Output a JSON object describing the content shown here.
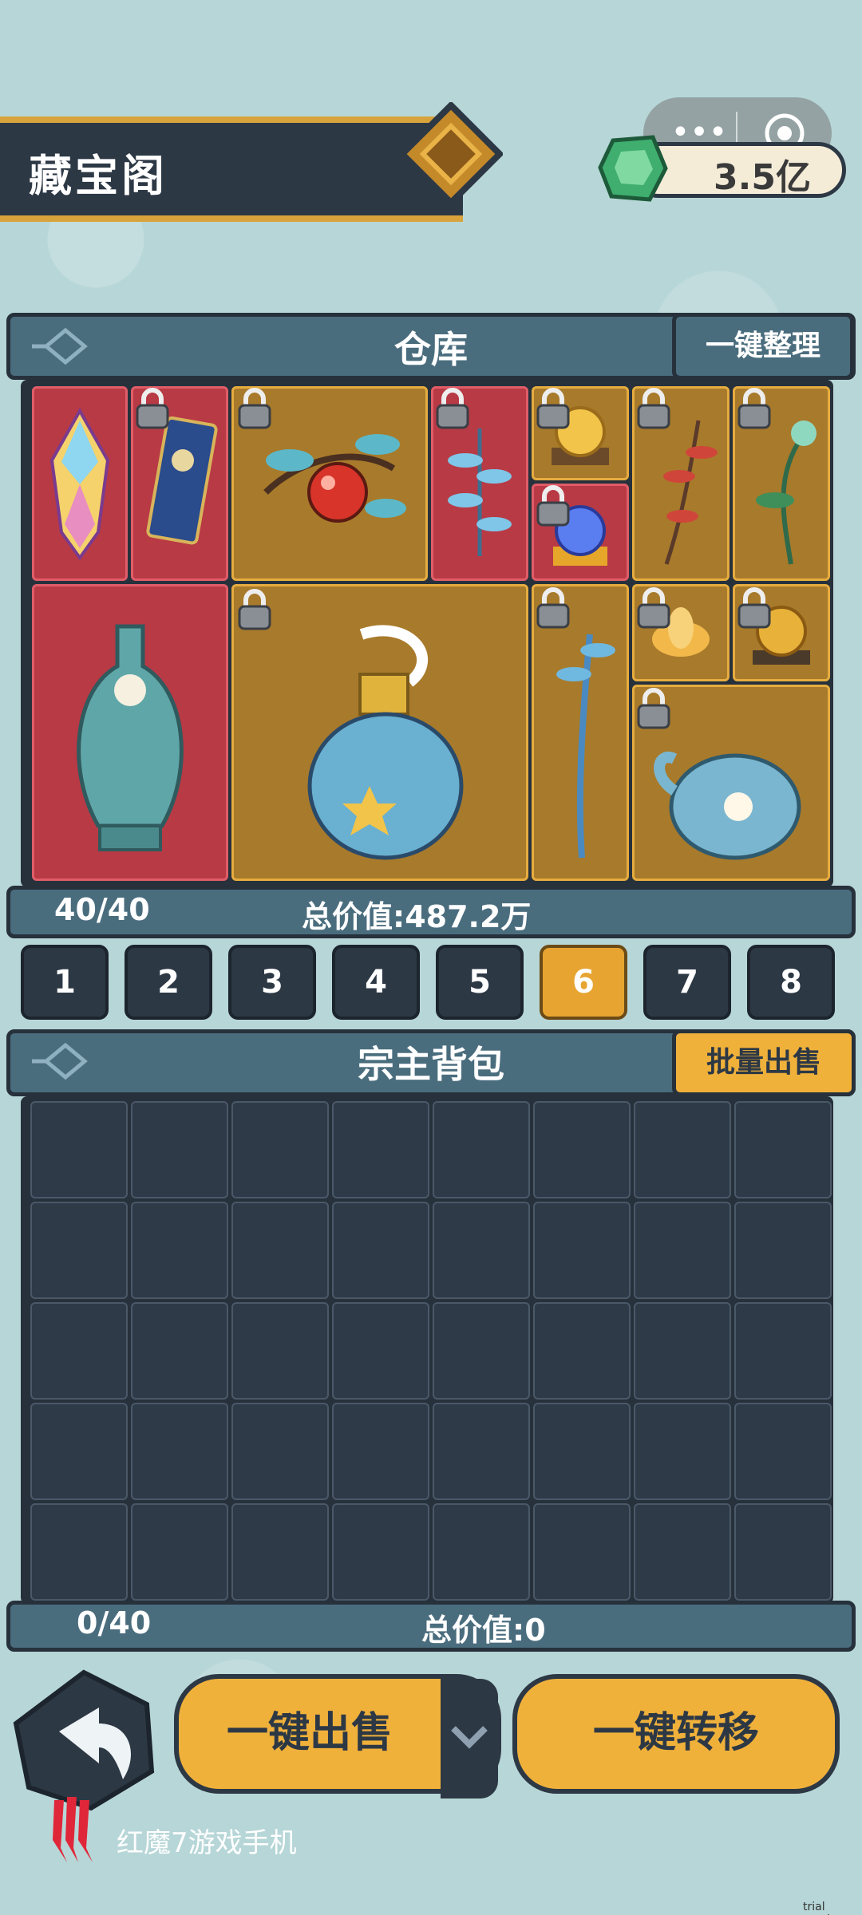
{
  "header": {
    "title": "藏宝阁",
    "currency": "3.5亿"
  },
  "warehouse": {
    "title": "仓库",
    "sort_button": "一键整理",
    "count": "40/40",
    "total_value": "总价值:487.2万"
  },
  "pages": {
    "labels": [
      "1",
      "2",
      "3",
      "4",
      "5",
      "6",
      "7",
      "8"
    ],
    "active": "6"
  },
  "backpack": {
    "title": "宗主背包",
    "batch_sell_button": "批量出售",
    "count": "0/40",
    "total_value": "总价值:0"
  },
  "actions": {
    "sell_all": "一键出售",
    "transfer_all": "一键转移"
  },
  "brand": {
    "text": "红魔7游戏手机"
  },
  "watermark": "trial version",
  "colors": {
    "accent_gold": "#f0b13b",
    "rarity_red": "#b83a45",
    "rarity_gold": "#a87a2b",
    "panel_dark": "#26313c",
    "panel_teal": "#4a6d7e"
  }
}
